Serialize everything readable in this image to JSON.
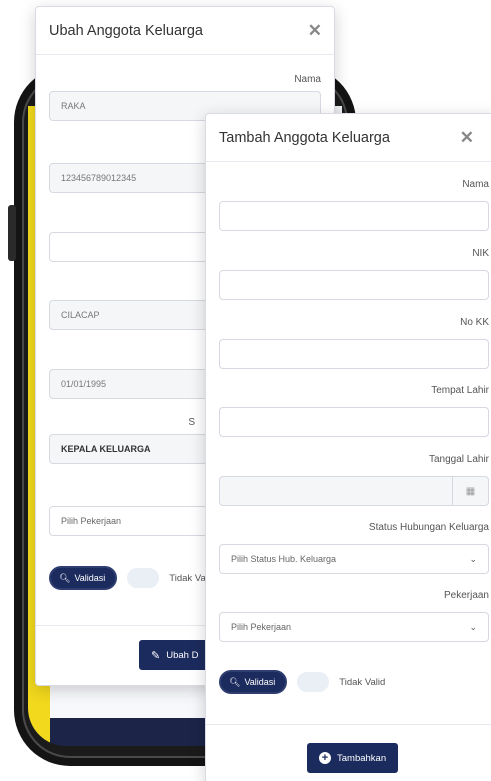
{
  "edit_modal": {
    "title": "Ubah Anggota Keluarga",
    "fields": {
      "nama_label": "Nama",
      "nama_value": "RAKA",
      "nik_value": "123456789012345",
      "kk_value": "",
      "tempat_value": "CILACAP",
      "tanggal_value": "01/01/1995",
      "status_label_fragment": "S",
      "status_value": "KEPALA KELUARGA",
      "pekerjaan_placeholder": "Pilih Pekerjaan"
    },
    "validate_label": "Validasi",
    "toggle_label": "Tidak Va",
    "submit_label": "Ubah D"
  },
  "add_modal": {
    "title": "Tambah Anggota Keluarga",
    "nama_label": "Nama",
    "nik_label": "NIK",
    "kk_label": "No KK",
    "tempat_label": "Tempat Lahir",
    "tanggal_label": "Tanggal Lahir",
    "status_label": "Status Hubungan Keluarga",
    "status_placeholder": "Pilih Status Hub. Keluarga",
    "pekerjaan_label": "Pekerjaan",
    "pekerjaan_placeholder": "Pilih Pekerjaan",
    "validate_label": "Validasi",
    "toggle_label": "Tidak Valid",
    "submit_label": "Tambahkan"
  },
  "colors": {
    "primary": "#1c2b5e",
    "accent_yellow": "#f2d91d"
  }
}
